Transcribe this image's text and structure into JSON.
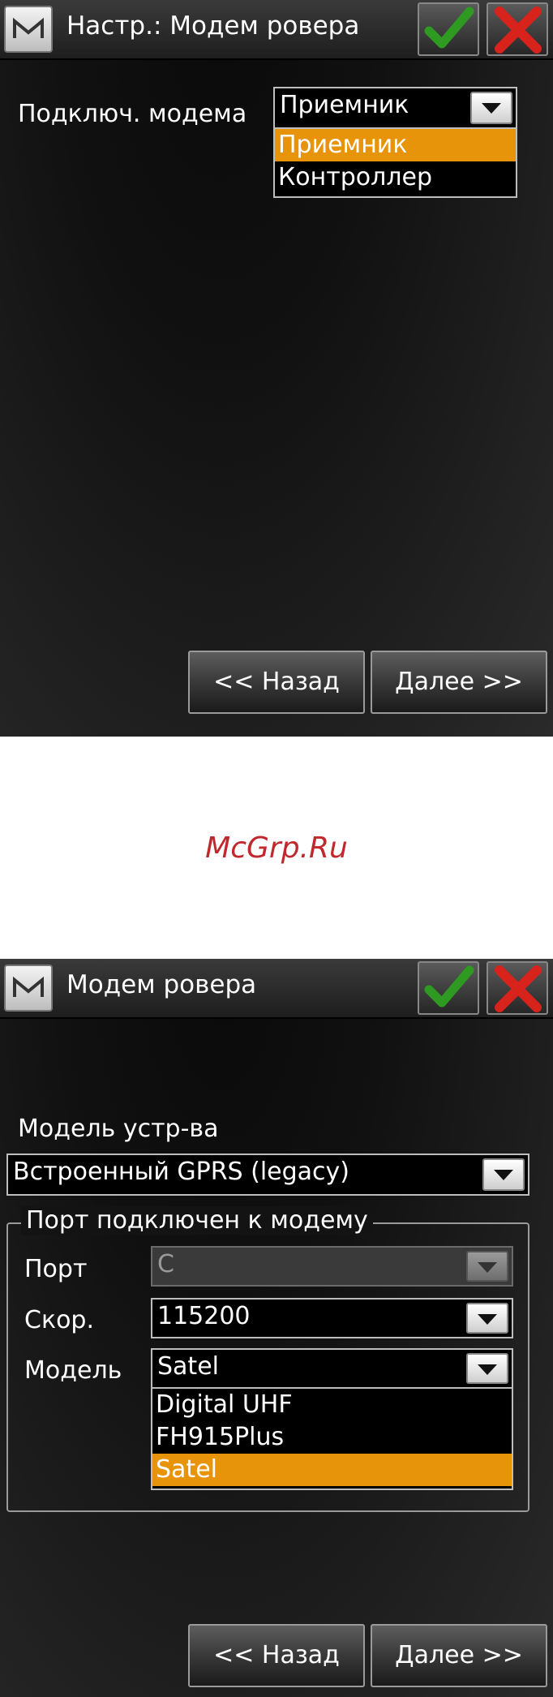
{
  "screen1": {
    "title": "Настр.: Модем ровера",
    "field_label": "Подключ. модема",
    "combo_value": "Приемник",
    "options": [
      "Приемник",
      "Контроллер"
    ],
    "selected_option": "Приемник",
    "back_label": "<< Назад",
    "next_label": "Далее >>"
  },
  "watermark": "McGrp.Ru",
  "screen2": {
    "title": "Модем ровера",
    "device_model_label": "Модель устр-ва",
    "device_model_value": "Встроенный GPRS (legacy)",
    "group_title": "Порт подключен к модему",
    "port_label": "Порт",
    "port_value": "C",
    "port_disabled": true,
    "speed_label": "Скор.",
    "speed_value": "115200",
    "model_label": "Модель",
    "model_value": "Satel",
    "model_options": [
      "Digital UHF",
      "FH915Plus",
      "Satel"
    ],
    "selected_model": "Satel",
    "back_label": "<< Назад",
    "next_label": "Далее >>"
  },
  "icons": {
    "app": "m-logo-icon",
    "ok": "checkmark-icon",
    "cancel": "red-x-icon",
    "dropdown": "down-triangle-icon"
  },
  "colors": {
    "selection": "#e8940a",
    "ok_green": "#2f9a22",
    "cancel_red": "#d8221c",
    "watermark": "#c0282d"
  }
}
